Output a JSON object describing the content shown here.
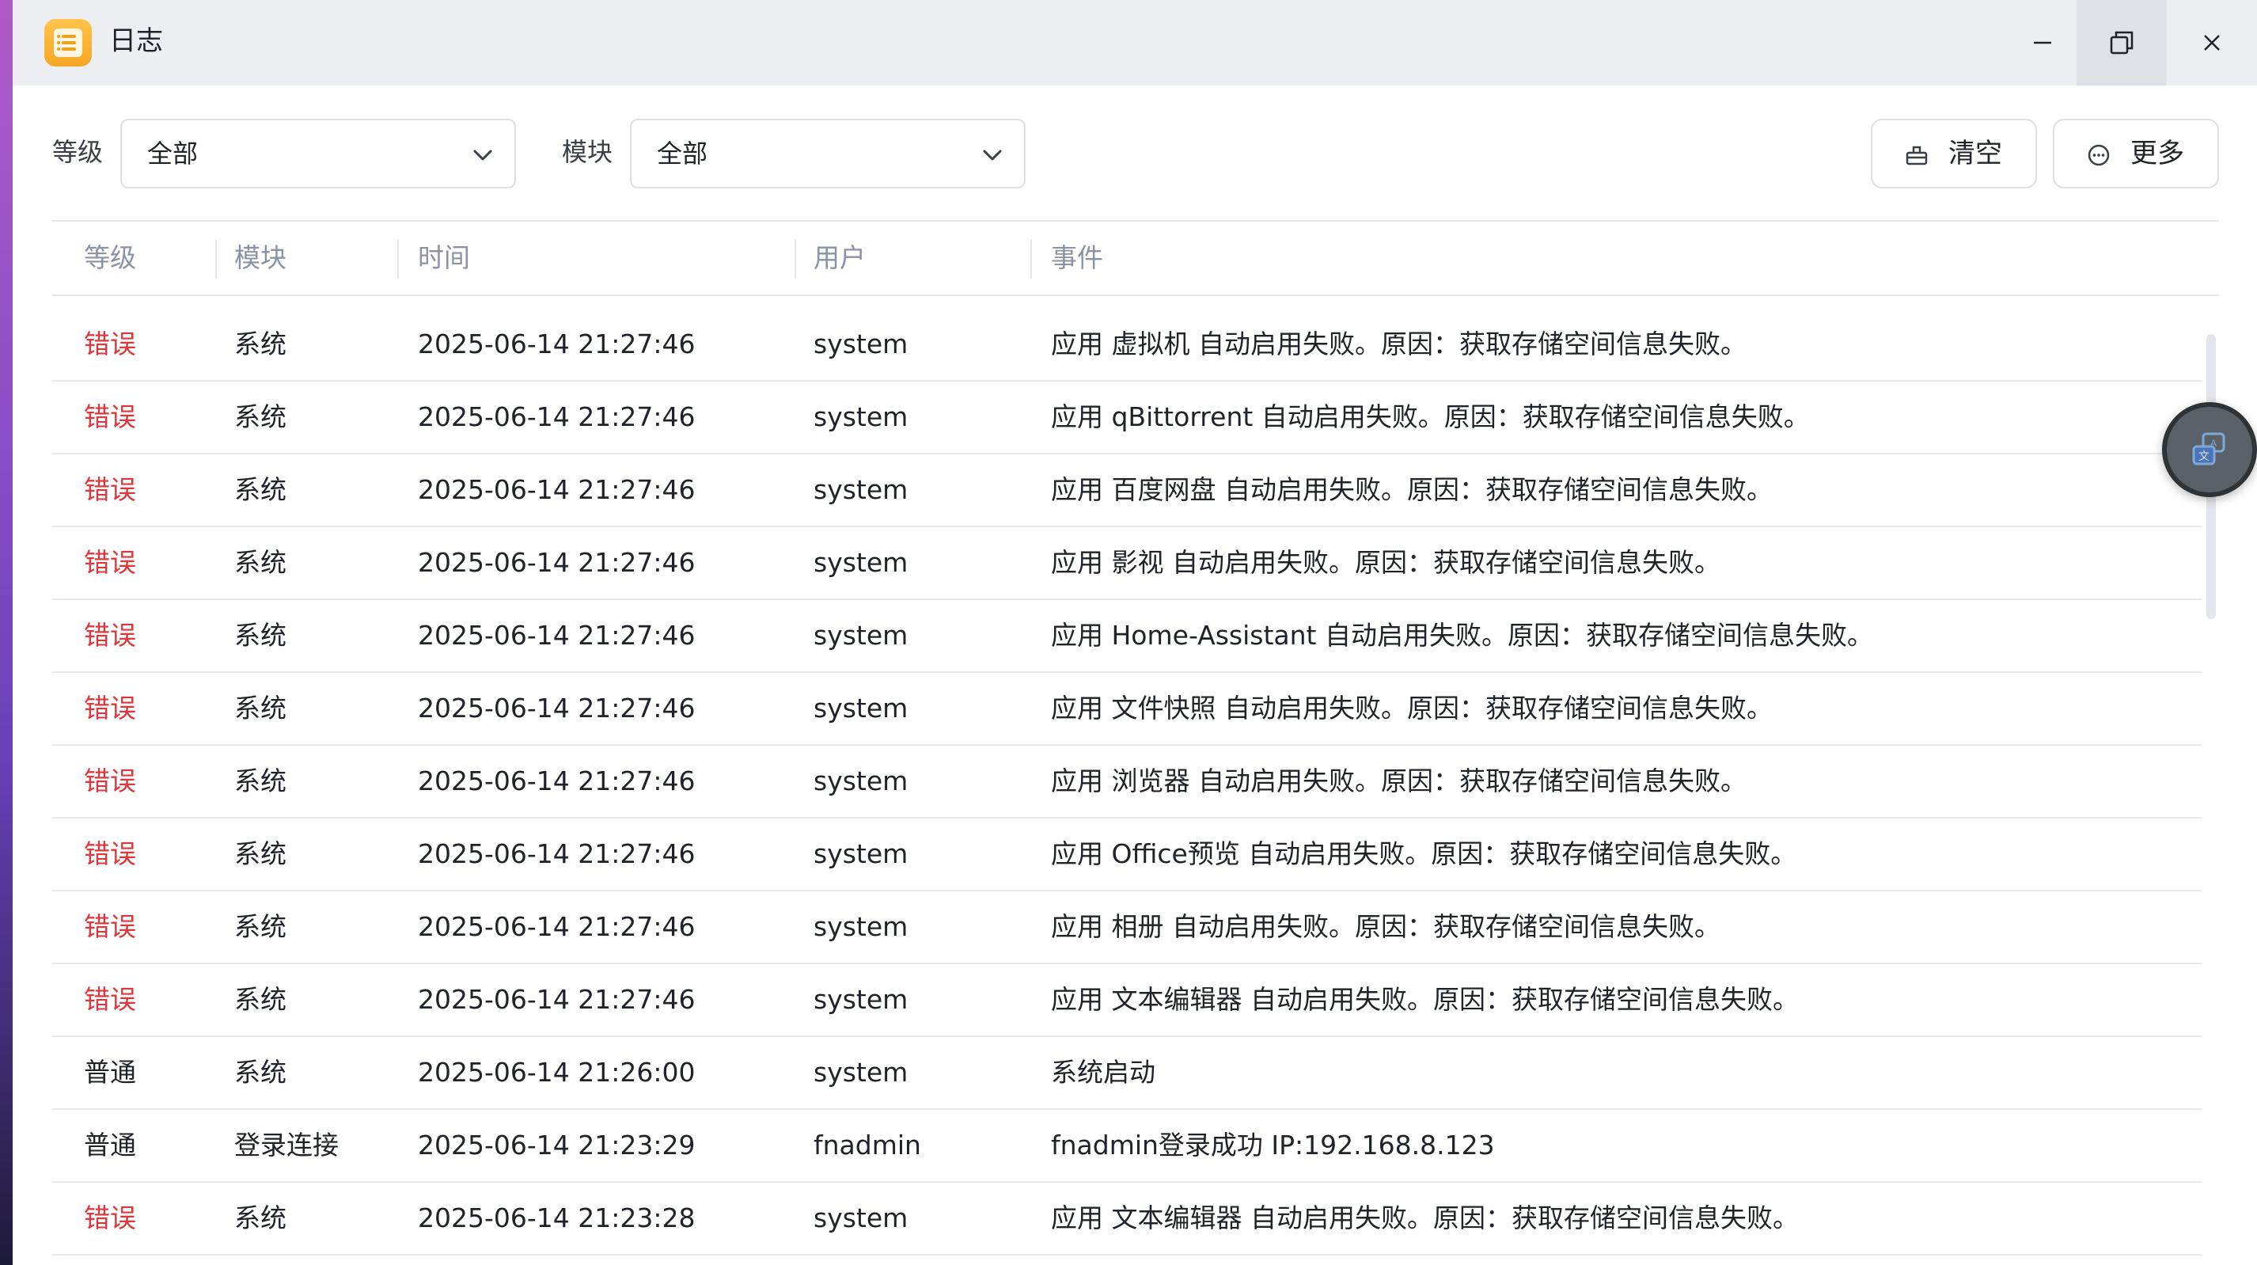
{
  "window": {
    "title": "日志",
    "icon": "log-app-icon",
    "controls": [
      "minimize-icon",
      "restore-icon",
      "close-icon"
    ]
  },
  "toolbar": {
    "level_label": "等级",
    "level_value": "全部",
    "module_label": "模块",
    "module_value": "全部",
    "clear_label": "清空",
    "more_label": "更多"
  },
  "table": {
    "headers": [
      "等级",
      "模块",
      "时间",
      "用户",
      "事件"
    ],
    "rows": [
      {
        "level": "错误",
        "module": "系统",
        "time": "2025-06-14 21:27:46",
        "user": "system",
        "event": "应用 虚拟机 自动启用失败。原因：获取存储空间信息失败。"
      },
      {
        "level": "错误",
        "module": "系统",
        "time": "2025-06-14 21:27:46",
        "user": "system",
        "event": "应用 qBittorrent 自动启用失败。原因：获取存储空间信息失败。"
      },
      {
        "level": "错误",
        "module": "系统",
        "time": "2025-06-14 21:27:46",
        "user": "system",
        "event": "应用 百度网盘 自动启用失败。原因：获取存储空间信息失败。"
      },
      {
        "level": "错误",
        "module": "系统",
        "time": "2025-06-14 21:27:46",
        "user": "system",
        "event": "应用 影视 自动启用失败。原因：获取存储空间信息失败。"
      },
      {
        "level": "错误",
        "module": "系统",
        "time": "2025-06-14 21:27:46",
        "user": "system",
        "event": "应用 Home-Assistant 自动启用失败。原因：获取存储空间信息失败。"
      },
      {
        "level": "错误",
        "module": "系统",
        "time": "2025-06-14 21:27:46",
        "user": "system",
        "event": "应用 文件快照 自动启用失败。原因：获取存储空间信息失败。"
      },
      {
        "level": "错误",
        "module": "系统",
        "time": "2025-06-14 21:27:46",
        "user": "system",
        "event": "应用 浏览器 自动启用失败。原因：获取存储空间信息失败。"
      },
      {
        "level": "错误",
        "module": "系统",
        "time": "2025-06-14 21:27:46",
        "user": "system",
        "event": "应用 Office预览 自动启用失败。原因：获取存储空间信息失败。"
      },
      {
        "level": "错误",
        "module": "系统",
        "time": "2025-06-14 21:27:46",
        "user": "system",
        "event": "应用 相册 自动启用失败。原因：获取存储空间信息失败。"
      },
      {
        "level": "错误",
        "module": "系统",
        "time": "2025-06-14 21:27:46",
        "user": "system",
        "event": "应用 文本编辑器 自动启用失败。原因：获取存储空间信息失败。"
      },
      {
        "level": "普通",
        "module": "系统",
        "time": "2025-06-14 21:26:00",
        "user": "system",
        "event": "系统启动"
      },
      {
        "level": "普通",
        "module": "登录连接",
        "time": "2025-06-14 21:23:29",
        "user": "fnadmin",
        "event": "fnadmin登录成功 IP:192.168.8.123"
      },
      {
        "level": "错误",
        "module": "系统",
        "time": "2025-06-14 21:23:28",
        "user": "system",
        "event": "应用 文本编辑器 自动启用失败。原因：获取存储空间信息失败。"
      }
    ]
  },
  "colors": {
    "error": "#e0353a",
    "normal": "#1f2329",
    "header_text": "#8a93a6",
    "titlebar": "#eceef2"
  },
  "floating_button": {
    "icon": "translate-icon"
  }
}
